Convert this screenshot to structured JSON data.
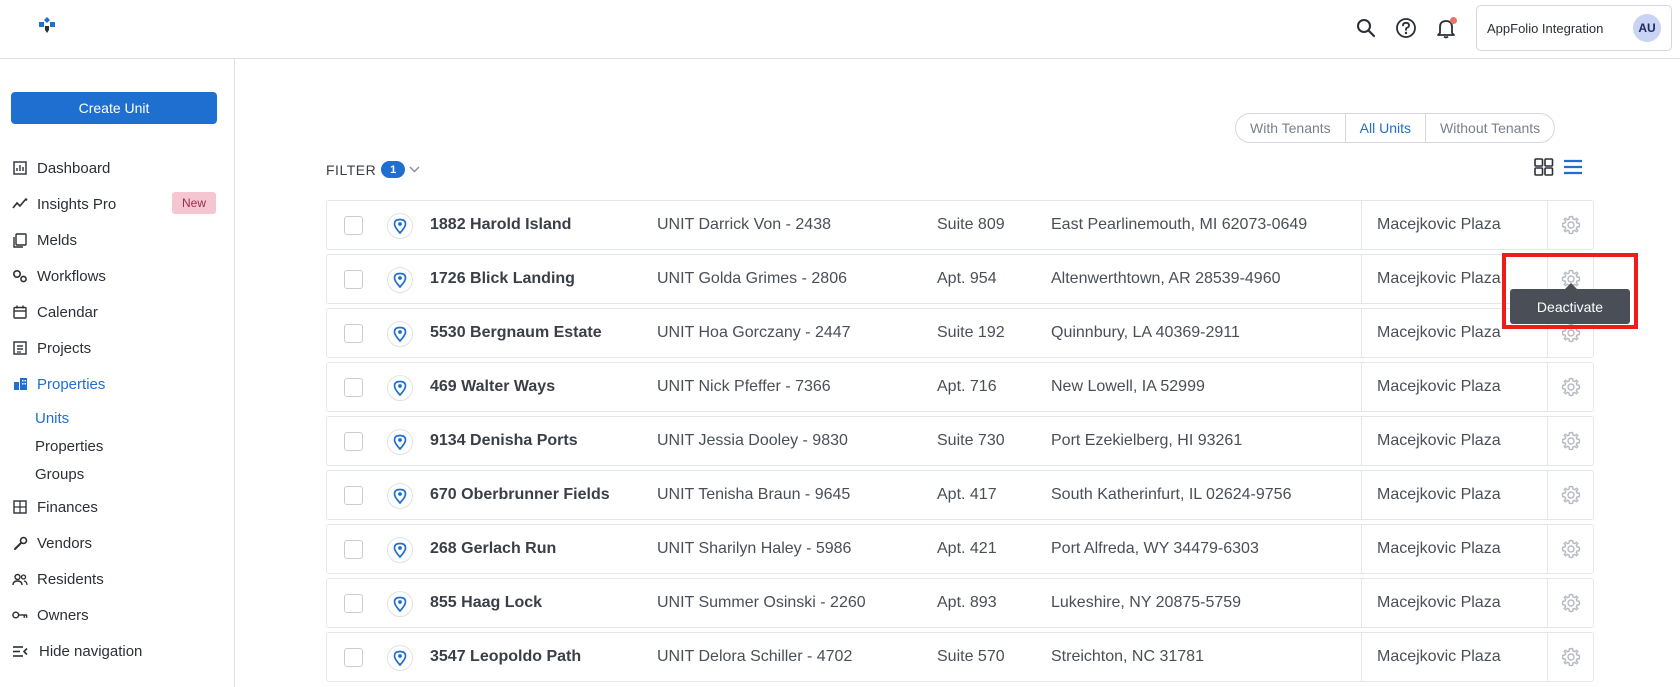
{
  "header": {
    "user_name": "AppFolio Integration",
    "avatar_initials": "AU",
    "brand_color": "#1f6fd0"
  },
  "sidebar": {
    "create_label": "Create Unit",
    "items": [
      {
        "label": "Dashboard",
        "icon": "dashboard-icon"
      },
      {
        "label": "Insights Pro",
        "icon": "insights-icon",
        "badge": "New"
      },
      {
        "label": "Melds",
        "icon": "melds-icon"
      },
      {
        "label": "Workflows",
        "icon": "workflows-icon"
      },
      {
        "label": "Calendar",
        "icon": "calendar-icon"
      },
      {
        "label": "Projects",
        "icon": "projects-icon"
      },
      {
        "label": "Properties",
        "icon": "properties-icon"
      },
      {
        "label": "Finances",
        "icon": "finances-icon"
      },
      {
        "label": "Vendors",
        "icon": "vendors-icon"
      },
      {
        "label": "Residents",
        "icon": "residents-icon"
      },
      {
        "label": "Owners",
        "icon": "owners-icon"
      },
      {
        "label": "Hide navigation",
        "icon": "hide-navigation-icon"
      }
    ],
    "sub_items": [
      "Units",
      "Properties",
      "Groups"
    ]
  },
  "toggle": {
    "with_tenants": "With Tenants",
    "all_units": "All Units",
    "without_tenants": "Without Tenants",
    "selected": "All Units"
  },
  "filter": {
    "label": "FILTER",
    "count": "1"
  },
  "rows": [
    {
      "address": "1882 Harold Island",
      "unit": "UNIT Darrick Von - 2438",
      "apt": "Suite 809",
      "city": "East Pearlinemouth, MI 62073-0649",
      "property": "Macejkovic Plaza"
    },
    {
      "address": "1726 Blick Landing",
      "unit": "UNIT Golda Grimes - 2806",
      "apt": "Apt. 954",
      "city": "Altenwerthtown, AR 28539-4960",
      "property": "Macejkovic Plaza"
    },
    {
      "address": "5530 Bergnaum Estate",
      "unit": "UNIT Hoa Gorczany - 2447",
      "apt": "Suite 192",
      "city": "Quinnbury, LA 40369-2911",
      "property": "Macejkovic Plaza"
    },
    {
      "address": "469 Walter Ways",
      "unit": "UNIT Nick Pfeffer - 7366",
      "apt": "Apt. 716",
      "city": "New Lowell, IA 52999",
      "property": "Macejkovic Plaza"
    },
    {
      "address": "9134 Denisha Ports",
      "unit": "UNIT Jessia Dooley - 9830",
      "apt": "Suite 730",
      "city": "Port Ezekielberg, HI 93261",
      "property": "Macejkovic Plaza"
    },
    {
      "address": "670 Oberbrunner Fields",
      "unit": "UNIT Tenisha Braun - 9645",
      "apt": "Apt. 417",
      "city": "South Katherinfurt, IL 02624-9756",
      "property": "Macejkovic Plaza"
    },
    {
      "address": "268 Gerlach Run",
      "unit": "UNIT Sharilyn Haley - 5986",
      "apt": "Apt. 421",
      "city": "Port Alfreda, WY 34479-6303",
      "property": "Macejkovic Plaza"
    },
    {
      "address": "855 Haag Lock",
      "unit": "UNIT Summer Osinski - 2260",
      "apt": "Apt. 893",
      "city": "Lukeshire, NY 20875-5759",
      "property": "Macejkovic Plaza"
    },
    {
      "address": "3547 Leopoldo Path",
      "unit": "UNIT Delora Schiller - 4702",
      "apt": "Suite 570",
      "city": "Streichton, NC 31781",
      "property": "Macejkovic Plaza"
    }
  ],
  "tooltip": "Deactivate",
  "highlight_color": "#ee1c1c"
}
